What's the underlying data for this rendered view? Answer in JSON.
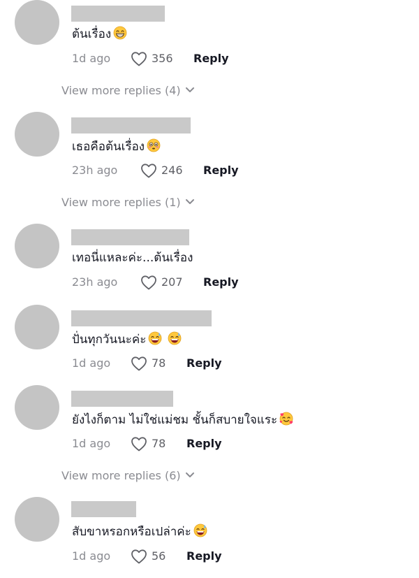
{
  "comments": [
    {
      "text": "ต้นเรื่อง",
      "emojis": [
        "grin-emoji"
      ],
      "time": "1d ago",
      "likes": "356",
      "reply_label": "Reply",
      "view_more": "View more replies (4)"
    },
    {
      "text": "เธอคือต้นเรื่อง",
      "emojis": [
        "flushed-emoji"
      ],
      "time": "23h ago",
      "likes": "246",
      "reply_label": "Reply",
      "view_more": "View more replies (1)"
    },
    {
      "text": "เทอนี่แหละค่ะ...ต้นเรื่อง",
      "emojis": [],
      "time": "23h ago",
      "likes": "207",
      "reply_label": "Reply",
      "view_more": ""
    },
    {
      "text": "ปั่นทุกวันนะค่ะ",
      "emojis": [
        "sweat-smile-emoji",
        "sweat-smile-emoji"
      ],
      "time": "1d ago",
      "likes": "78",
      "reply_label": "Reply",
      "view_more": ""
    },
    {
      "text": "ยังไงก็ตาม ไม่ใช่แม่ชม ชั้นก็สบายใจแระ",
      "emojis": [
        "smiling-face-with-hearts-emoji"
      ],
      "time": "1d ago",
      "likes": "78",
      "reply_label": "Reply",
      "view_more": "View more replies (6)"
    },
    {
      "text": "สับขาหรอกหรือเปล่าค่ะ",
      "emojis": [
        "sweat-smile-emoji"
      ],
      "time": "1d ago",
      "likes": "56",
      "reply_label": "Reply",
      "view_more": ""
    }
  ],
  "colors": {
    "avatar_placeholder": "#c4c4c4",
    "name_placeholder": "#c9c9c9",
    "muted_text": "#8a8b91",
    "primary_text": "#161823",
    "emoji_yellow": "#ffc83d"
  }
}
